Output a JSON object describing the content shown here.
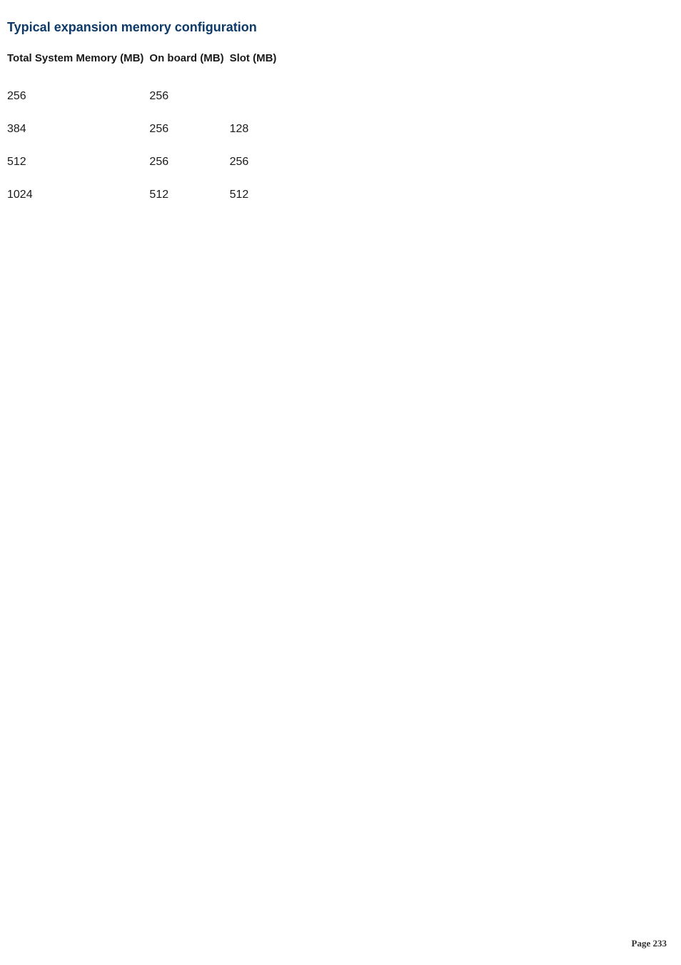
{
  "heading": "Typical expansion memory configuration",
  "table": {
    "headers": [
      "Total System Memory (MB)",
      "On board (MB)",
      "Slot (MB)"
    ],
    "rows": [
      [
        "256",
        "256",
        ""
      ],
      [
        "384",
        "256",
        "128"
      ],
      [
        "512",
        "256",
        "256"
      ],
      [
        "1024",
        "512",
        "512"
      ]
    ]
  },
  "footer": "Page 233"
}
